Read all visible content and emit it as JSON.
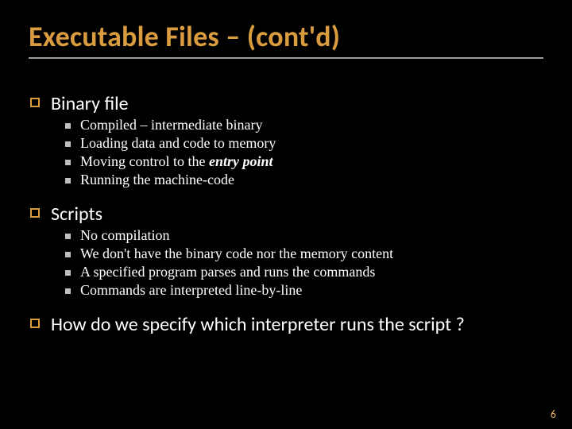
{
  "title": "Executable Files – (cont'd)",
  "items": [
    {
      "label": "Binary file",
      "sub": [
        "Compiled – intermediate binary",
        "Loading data and code to memory",
        "Moving control to the ",
        "Running the machine-code"
      ],
      "sub_em_2": "entry point"
    },
    {
      "label": "Scripts",
      "sub": [
        "No compilation",
        "We don't have the binary code nor the memory content",
        "A specified program parses and runs the commands",
        "Commands are interpreted line-by-line"
      ]
    },
    {
      "label": "How do we specify which interpreter runs the script ?",
      "sub": []
    }
  ],
  "page_number": "6"
}
